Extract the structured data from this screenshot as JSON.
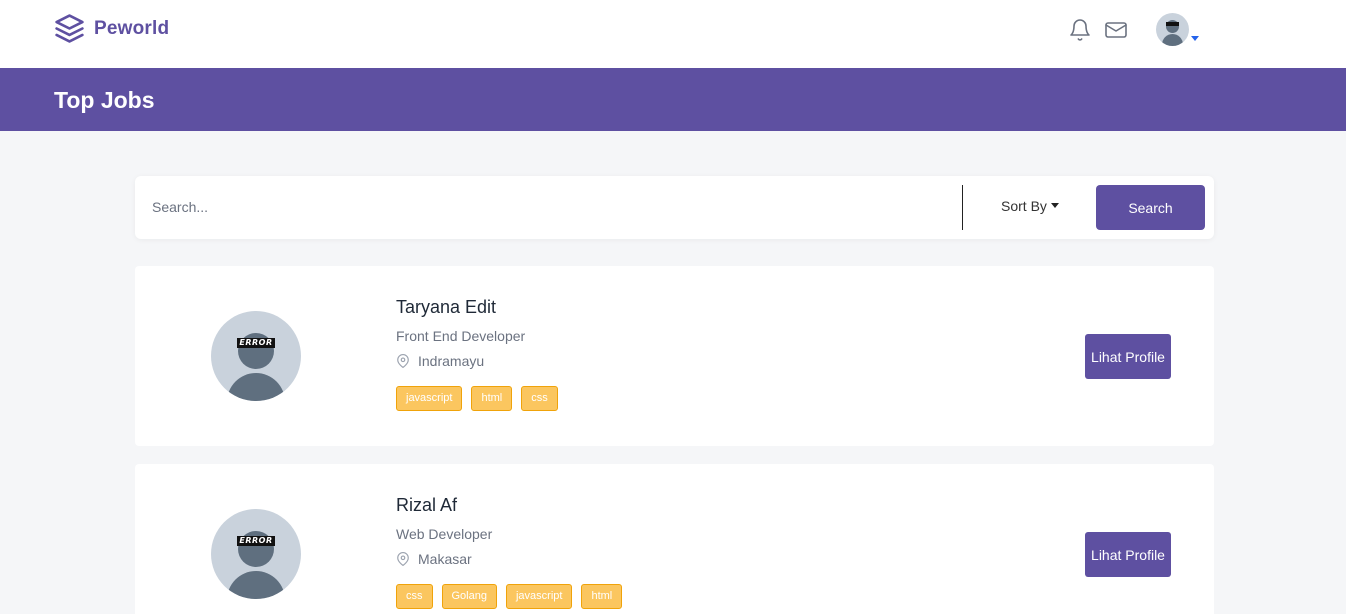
{
  "brand": {
    "name": "Peworld",
    "logo_icon": "stacked-layers-icon"
  },
  "header": {
    "notification_icon": "bell-icon",
    "message_icon": "mail-icon",
    "avatar_caret_icon": "caret-down-icon"
  },
  "banner": {
    "title": "Top Jobs"
  },
  "search": {
    "placeholder": "Search...",
    "sort_label": "Sort By",
    "button_label": "Search"
  },
  "candidates": [
    {
      "name": "Taryana Edit",
      "role": "Front End Developer",
      "location": "Indramayu",
      "skills": [
        "javascript",
        "html",
        "css"
      ],
      "button_label": "Lihat Profile",
      "avatar_text": "ERROR"
    },
    {
      "name": "Rizal Af",
      "role": "Web Developer",
      "location": "Makasar",
      "skills": [
        "css",
        "Golang",
        "javascript",
        "html"
      ],
      "button_label": "Lihat Profile",
      "avatar_text": "ERROR"
    }
  ],
  "colors": {
    "primary": "#5e50a1",
    "skill_bg": "#fbc65f",
    "skill_border": "#f0a30a",
    "page_bg": "#f5f6f8"
  }
}
